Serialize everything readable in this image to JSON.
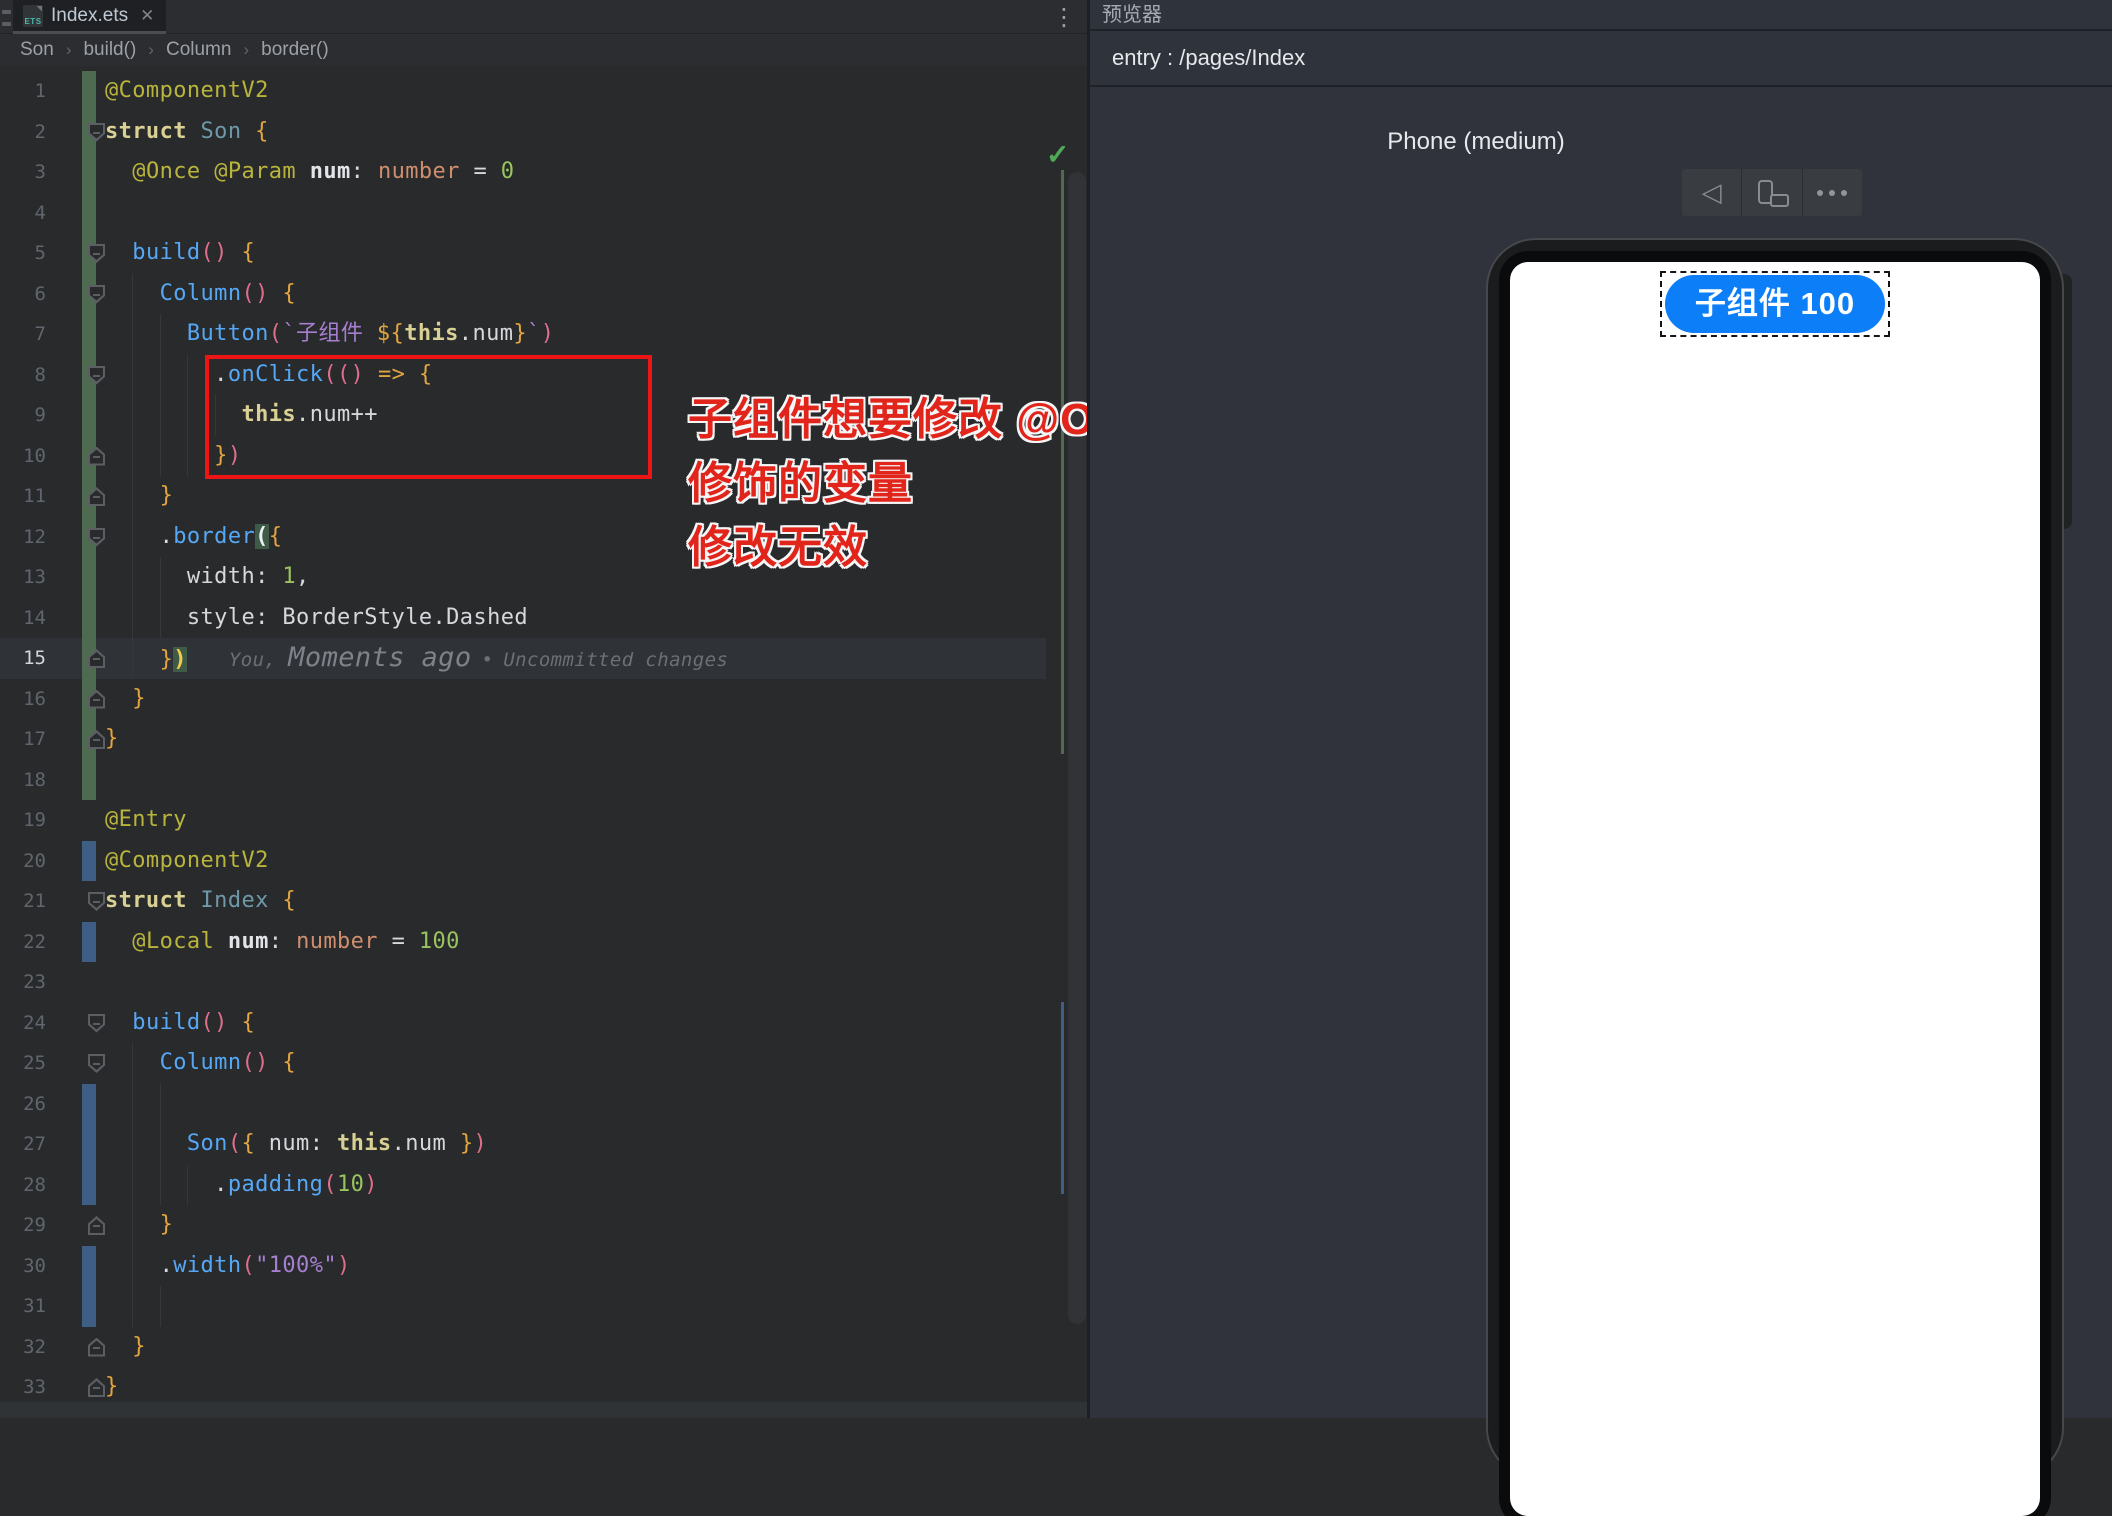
{
  "colors": {
    "accent_blue_button": "#0C7EF8",
    "annotation_red": "#E1251B",
    "change_added_green": "#4E6A50",
    "change_modified_blue": "#3F5E86",
    "editor_bg": "#282A2C",
    "preview_bg": "#30333C"
  },
  "editor": {
    "tab": {
      "title": "Index.ets",
      "icon_label": "ETS",
      "close_glyph": "✕"
    },
    "kebab_glyph": "⋮",
    "breadcrumb": {
      "items": [
        "Son",
        "build()",
        "Column",
        "border()"
      ],
      "separator": "›"
    },
    "inspection_check_glyph": "✓",
    "blame": {
      "author": "You,",
      "time": "Moments ago",
      "separator": "•",
      "status": "Uncommitted changes"
    },
    "annotation": {
      "line1": "子组件想要修改 @Once 和 @Param修饰的变量",
      "line2": "修改无效"
    },
    "lines": [
      {
        "n": 1,
        "bar": "g",
        "guides": 0,
        "t": [
          [
            "a",
            "@ComponentV2"
          ]
        ]
      },
      {
        "n": 2,
        "bar": "g",
        "fold": "d",
        "guides": 0,
        "t": [
          [
            "k",
            "struct"
          ],
          [
            "w",
            " "
          ],
          [
            "c",
            "Son"
          ],
          [
            "w",
            " "
          ],
          [
            "b",
            "{"
          ]
        ]
      },
      {
        "n": 3,
        "bar": "g",
        "guides": 0,
        "t": [
          [
            "w",
            "  "
          ],
          [
            "a",
            "@Once"
          ],
          [
            "w",
            " "
          ],
          [
            "a",
            "@Param"
          ],
          [
            "w",
            " "
          ],
          [
            "o",
            "num"
          ],
          [
            "w",
            ": "
          ],
          [
            "t",
            "number"
          ],
          [
            "w",
            " = "
          ],
          [
            "n",
            "0"
          ]
        ]
      },
      {
        "n": 4,
        "bar": "g",
        "guides": 0,
        "t": []
      },
      {
        "n": 5,
        "bar": "g",
        "fold": "d",
        "guides": 0,
        "t": [
          [
            "w",
            "  "
          ],
          [
            "f",
            "build"
          ],
          [
            "p",
            "()"
          ],
          [
            "w",
            " "
          ],
          [
            "b",
            "{"
          ]
        ]
      },
      {
        "n": 6,
        "bar": "g",
        "fold": "d",
        "guides": 1,
        "t": [
          [
            "w",
            "    "
          ],
          [
            "f",
            "Column"
          ],
          [
            "p",
            "()"
          ],
          [
            "w",
            " "
          ],
          [
            "b",
            "{"
          ]
        ]
      },
      {
        "n": 7,
        "bar": "g",
        "guides": 2,
        "t": [
          [
            "w",
            "      "
          ],
          [
            "f",
            "Button"
          ],
          [
            "p",
            "("
          ],
          [
            "s",
            "`子组件 "
          ],
          [
            "b",
            "${"
          ],
          [
            "k",
            "this"
          ],
          [
            "w",
            ".num"
          ],
          [
            "b",
            "}"
          ],
          [
            "s",
            "`"
          ],
          [
            "p",
            ")"
          ]
        ]
      },
      {
        "n": 8,
        "bar": "g",
        "fold": "d",
        "guides": 3,
        "t": [
          [
            "w",
            "        ."
          ],
          [
            "f",
            "onClick"
          ],
          [
            "p",
            "(()"
          ],
          [
            "w",
            " "
          ],
          [
            "b",
            "=>"
          ],
          [
            "w",
            " "
          ],
          [
            "b",
            "{"
          ]
        ]
      },
      {
        "n": 9,
        "bar": "g",
        "guides": 4,
        "t": [
          [
            "w",
            "          "
          ],
          [
            "k",
            "this"
          ],
          [
            "w",
            ".num++"
          ]
        ]
      },
      {
        "n": 10,
        "bar": "g",
        "fold": "u",
        "guides": 3,
        "t": [
          [
            "w",
            "        "
          ],
          [
            "b",
            "}"
          ],
          [
            "p",
            ")"
          ]
        ]
      },
      {
        "n": 11,
        "bar": "g",
        "fold": "u",
        "guides": 1,
        "t": [
          [
            "w",
            "    "
          ],
          [
            "b",
            "}"
          ]
        ]
      },
      {
        "n": 12,
        "bar": "g",
        "fold": "d",
        "guides": 1,
        "t": [
          [
            "w",
            "    ."
          ],
          [
            "f",
            "border"
          ],
          [
            "x",
            "("
          ],
          [
            "b",
            "{"
          ]
        ]
      },
      {
        "n": 13,
        "bar": "g",
        "guides": 2,
        "t": [
          [
            "w",
            "      width: "
          ],
          [
            "n",
            "1"
          ],
          [
            "w",
            ","
          ]
        ]
      },
      {
        "n": 14,
        "bar": "g",
        "guides": 2,
        "t": [
          [
            "w",
            "      style: BorderStyle.Dashed"
          ]
        ]
      },
      {
        "n": 15,
        "bar": "g",
        "fold": "u",
        "cur": true,
        "blame": true,
        "guides": 1,
        "t": [
          [
            "w",
            "    "
          ],
          [
            "b",
            "}"
          ],
          [
            "y",
            ")"
          ]
        ]
      },
      {
        "n": 16,
        "bar": "g",
        "fold": "u",
        "guides": 0,
        "t": [
          [
            "w",
            "  "
          ],
          [
            "b",
            "}"
          ]
        ]
      },
      {
        "n": 17,
        "bar": "g",
        "fold": "u",
        "guides": 0,
        "t": [
          [
            "b",
            "}"
          ]
        ]
      },
      {
        "n": 18,
        "bar": "g",
        "guides": 0,
        "t": []
      },
      {
        "n": 19,
        "guides": 0,
        "t": [
          [
            "a",
            "@Entry"
          ]
        ]
      },
      {
        "n": 20,
        "bar": "b",
        "guides": 0,
        "t": [
          [
            "a",
            "@ComponentV2"
          ]
        ]
      },
      {
        "n": 21,
        "fold": "d",
        "guides": 0,
        "t": [
          [
            "k",
            "struct"
          ],
          [
            "w",
            " "
          ],
          [
            "c",
            "Index"
          ],
          [
            "w",
            " "
          ],
          [
            "b",
            "{"
          ]
        ]
      },
      {
        "n": 22,
        "bar": "b",
        "guides": 0,
        "t": [
          [
            "w",
            "  "
          ],
          [
            "a",
            "@Local"
          ],
          [
            "w",
            " "
          ],
          [
            "o",
            "num"
          ],
          [
            "w",
            ": "
          ],
          [
            "t",
            "number"
          ],
          [
            "w",
            " = "
          ],
          [
            "n",
            "100"
          ]
        ]
      },
      {
        "n": 23,
        "guides": 0,
        "t": []
      },
      {
        "n": 24,
        "fold": "d",
        "guides": 0,
        "t": [
          [
            "w",
            "  "
          ],
          [
            "f",
            "build"
          ],
          [
            "p",
            "()"
          ],
          [
            "w",
            " "
          ],
          [
            "b",
            "{"
          ]
        ]
      },
      {
        "n": 25,
        "fold": "d",
        "guides": 1,
        "t": [
          [
            "w",
            "    "
          ],
          [
            "f",
            "Column"
          ],
          [
            "p",
            "()"
          ],
          [
            "w",
            " "
          ],
          [
            "b",
            "{"
          ]
        ]
      },
      {
        "n": 26,
        "bar": "b",
        "guides": 2,
        "t": []
      },
      {
        "n": 27,
        "bar": "b",
        "guides": 2,
        "t": [
          [
            "w",
            "      "
          ],
          [
            "f",
            "Son"
          ],
          [
            "p",
            "("
          ],
          [
            "b",
            "{"
          ],
          [
            "w",
            " num: "
          ],
          [
            "k",
            "this"
          ],
          [
            "w",
            ".num "
          ],
          [
            "b",
            "}"
          ],
          [
            "p",
            ")"
          ]
        ]
      },
      {
        "n": 28,
        "bar": "b",
        "guides": 3,
        "t": [
          [
            "w",
            "        ."
          ],
          [
            "f",
            "padding"
          ],
          [
            "p",
            "("
          ],
          [
            "n",
            "10"
          ],
          [
            "p",
            ")"
          ]
        ]
      },
      {
        "n": 29,
        "fold": "u",
        "guides": 1,
        "t": [
          [
            "w",
            "    "
          ],
          [
            "b",
            "}"
          ]
        ]
      },
      {
        "n": 30,
        "bar": "b",
        "guides": 1,
        "t": [
          [
            "w",
            "    ."
          ],
          [
            "f",
            "width"
          ],
          [
            "p",
            "("
          ],
          [
            "s",
            "\"100%\""
          ],
          [
            "p",
            ")"
          ]
        ]
      },
      {
        "n": 31,
        "bar": "b",
        "guides": 2,
        "t": []
      },
      {
        "n": 32,
        "fold": "u",
        "guides": 0,
        "t": [
          [
            "w",
            "  "
          ],
          [
            "b",
            "}"
          ]
        ]
      },
      {
        "n": 33,
        "fold": "u",
        "guides": 0,
        "t": [
          [
            "b",
            "}"
          ]
        ]
      }
    ]
  },
  "preview": {
    "panel_title": "预览器",
    "entry_label": "entry : /pages/Index",
    "device_label": "Phone (medium)",
    "toolbar_icons": [
      "back-icon",
      "rotate-device-icon",
      "more-icon"
    ],
    "screen_button_label": "子组件 100"
  }
}
